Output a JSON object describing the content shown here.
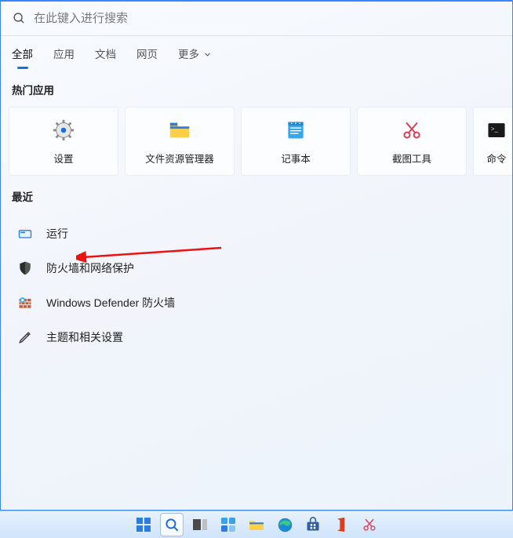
{
  "search": {
    "placeholder": "在此键入进行搜索"
  },
  "tabs": {
    "all": "全部",
    "apps": "应用",
    "docs": "文档",
    "web": "网页",
    "more": "更多"
  },
  "sections": {
    "hot": "热门应用",
    "recent": "最近"
  },
  "tiles": {
    "settings": "设置",
    "explorer": "文件资源管理器",
    "notepad": "记事本",
    "snip": "截图工具",
    "cmd": "命令"
  },
  "recent": {
    "run": "运行",
    "firewall": "防火墙和网络保护",
    "defender": "Windows Defender 防火墙",
    "theme": "主题和相关设置"
  },
  "taskbar_tips": {
    "start": "开始",
    "search": "搜索",
    "taskview": "任务视图",
    "widgets": "小组件",
    "explorer": "文件资源管理器",
    "edge": "Edge",
    "store": "Microsoft Store",
    "office": "Office",
    "snip": "截图工具"
  }
}
